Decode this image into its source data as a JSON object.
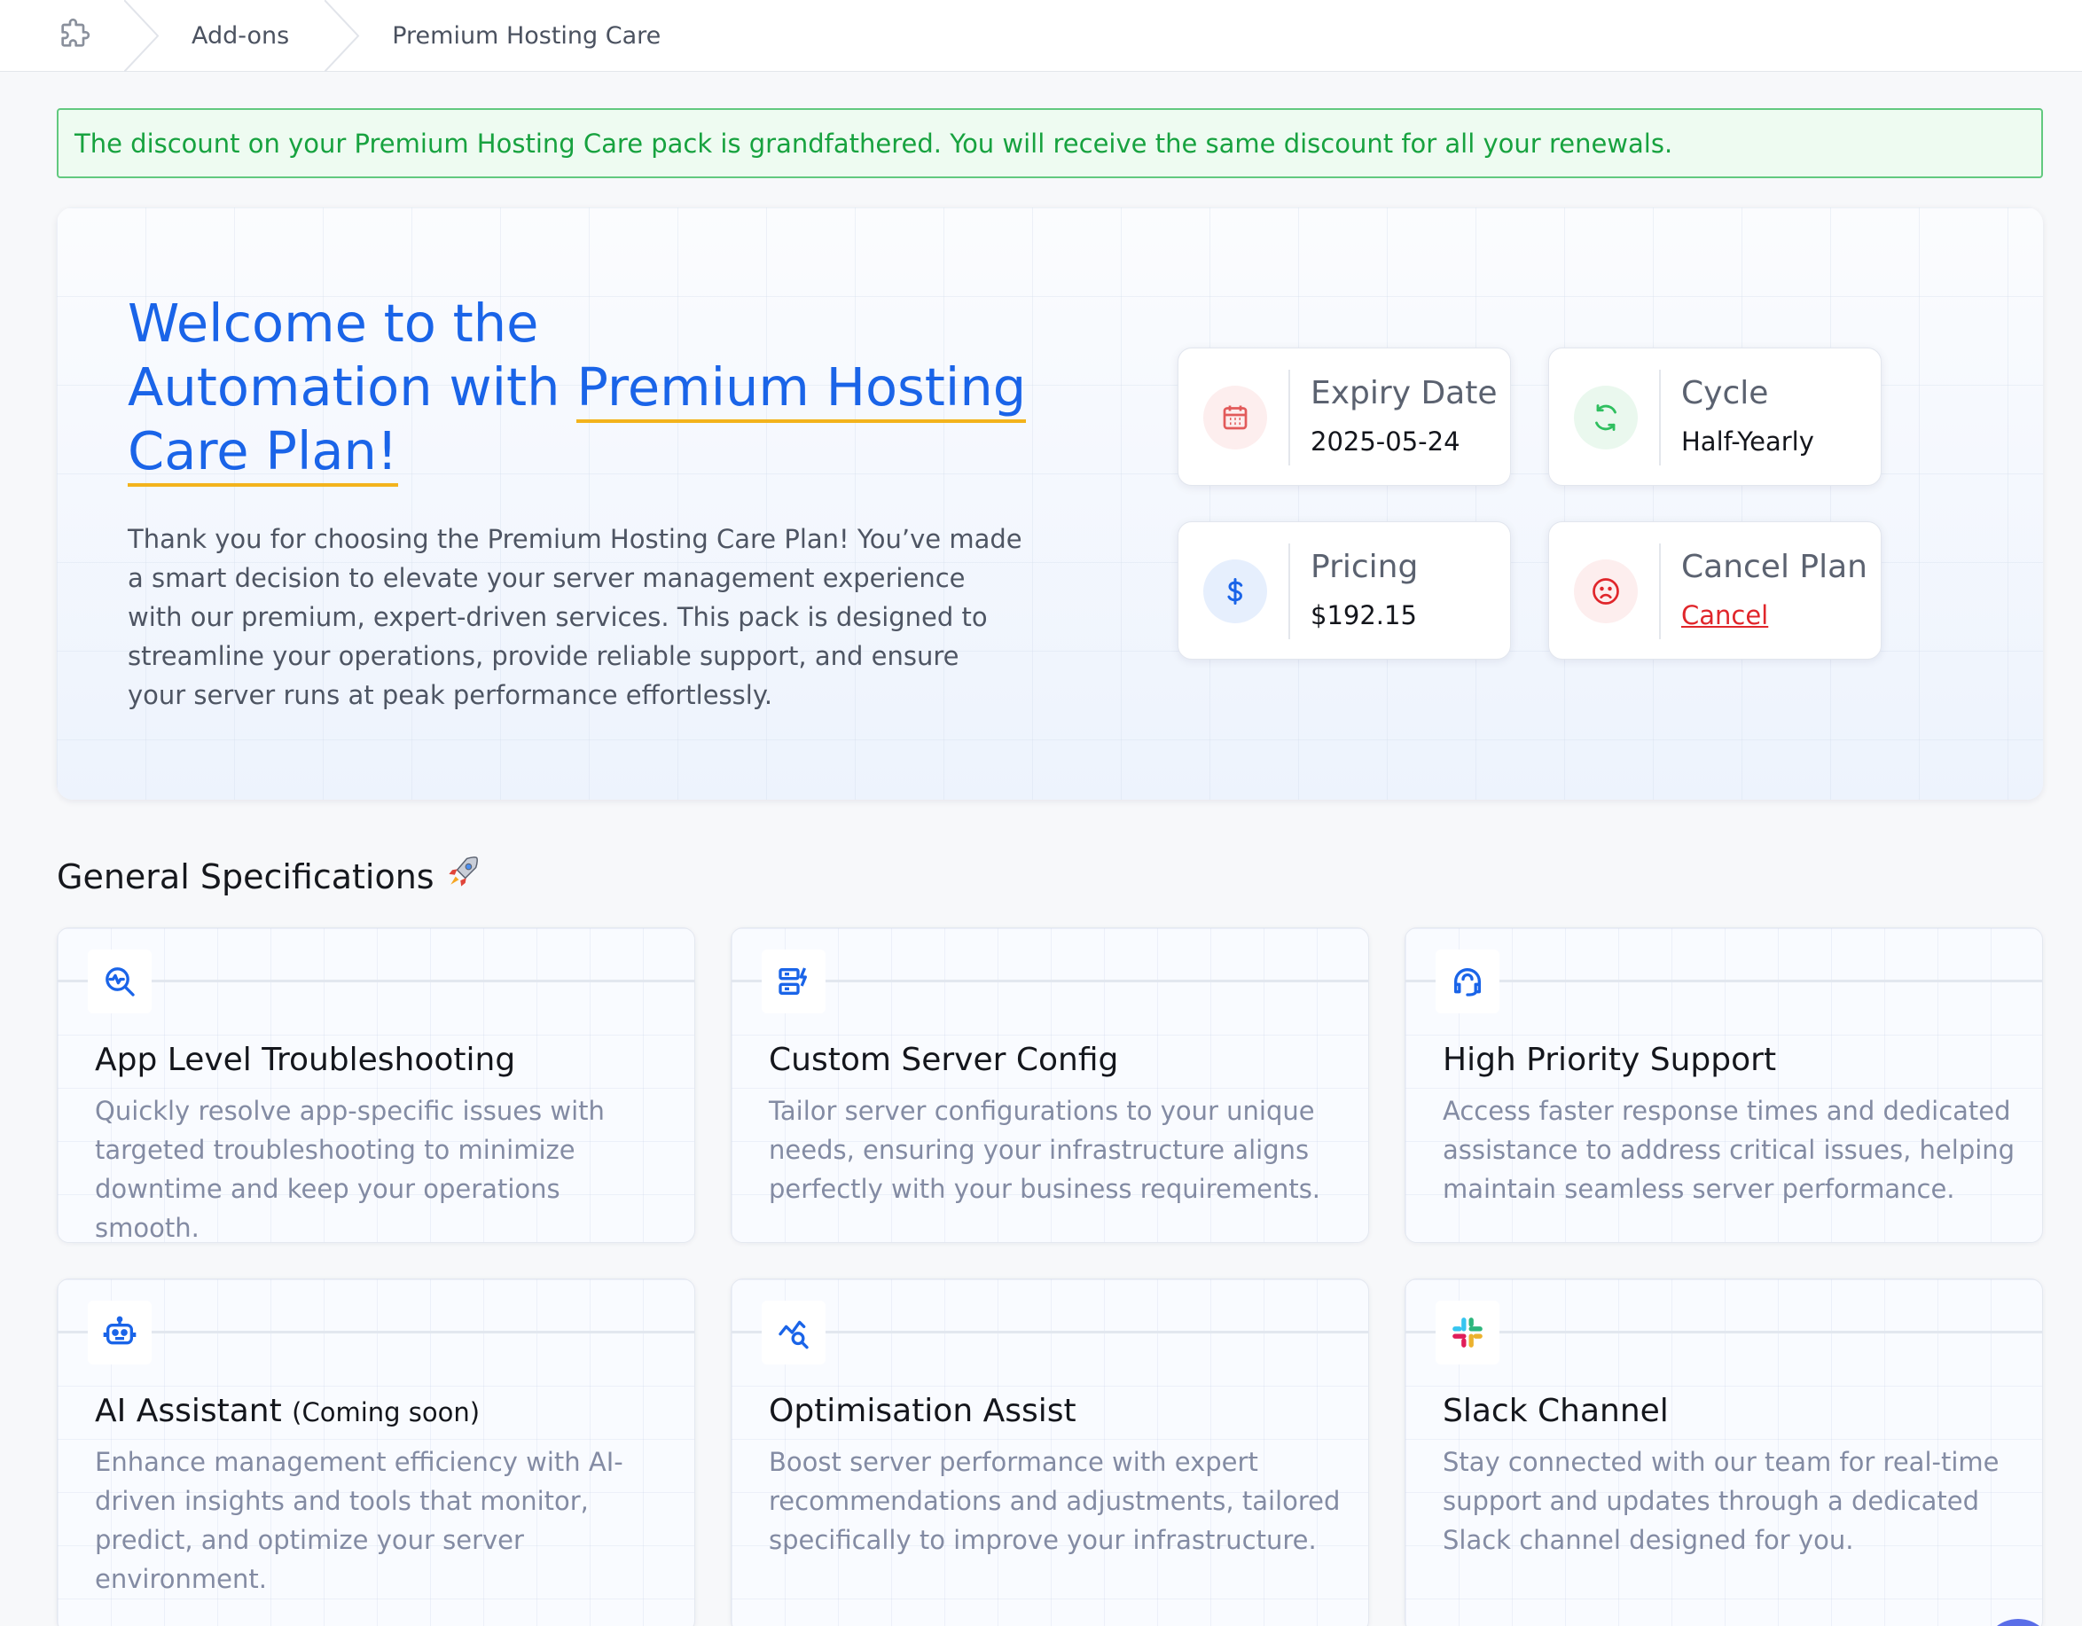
{
  "breadcrumb": {
    "home_icon": "puzzle-icon",
    "items": [
      "Add-ons",
      "Premium Hosting Care"
    ]
  },
  "alert": {
    "text": "The discount on your Premium Hosting Care pack is grandfathered. You will receive the same discount for all your renewals."
  },
  "welcome": {
    "title_line1": "Welcome to the",
    "title_line2_prefix": "Automation with ",
    "title_line2_em": "Premium Hosting",
    "title_line3_em": "Care Plan!",
    "description": "Thank you for choosing the Premium Hosting Care Plan! You’ve made a smart decision to elevate your server management experience with our premium, expert-driven services. This pack is designed to streamline your operations, provide reliable support, and ensure your server runs at peak performance effortlessly."
  },
  "info_cards": {
    "expiry": {
      "label": "Expiry Date",
      "value": "2025-05-24",
      "icon": "calendar-icon"
    },
    "cycle": {
      "label": "Cycle",
      "value": "Half-Yearly",
      "icon": "refresh-icon"
    },
    "pricing": {
      "label": "Pricing",
      "value": "$192.15",
      "icon": "dollar-icon"
    },
    "cancel": {
      "label": "Cancel Plan",
      "value": "Cancel",
      "icon": "sad-face-icon"
    }
  },
  "section": {
    "title": "General Specifications",
    "emoji_icon": "rocket-icon"
  },
  "features": [
    {
      "title": "App Level Troubleshooting",
      "title_suffix": "",
      "icon": "search-pulse-icon",
      "description": "Quickly resolve app-specific issues with targeted troubleshooting to minimize downtime and keep your operations smooth."
    },
    {
      "title": "Custom Server Config",
      "title_suffix": "",
      "icon": "server-bolt-icon",
      "description": "Tailor server configurations to your unique needs, ensuring your infrastructure aligns perfectly with your business requirements."
    },
    {
      "title": "High Priority Support",
      "title_suffix": "",
      "icon": "headset-icon",
      "description": "Access faster response times and dedicated assistance to address critical issues, helping maintain seamless server performance."
    },
    {
      "title": "AI Assistant ",
      "title_suffix": "(Coming soon)",
      "icon": "robot-icon",
      "description": "Enhance management efficiency with AI-driven insights and tools that monitor, predict, and optimize your server environment."
    },
    {
      "title": "Optimisation Assist",
      "title_suffix": "",
      "icon": "chart-search-icon",
      "description": "Boost server performance with expert recommendations and adjustments, tailored specifically to improve your infrastructure."
    },
    {
      "title": "Slack Channel",
      "title_suffix": "",
      "icon": "slack-icon",
      "description": "Stay connected with our team for real-time support and updates through a dedicated Slack channel designed for you."
    }
  ],
  "colors": {
    "primary": "#1a64e8",
    "accent_underline": "#f3b31c",
    "success": "#17a23f",
    "danger": "#e0262b"
  }
}
